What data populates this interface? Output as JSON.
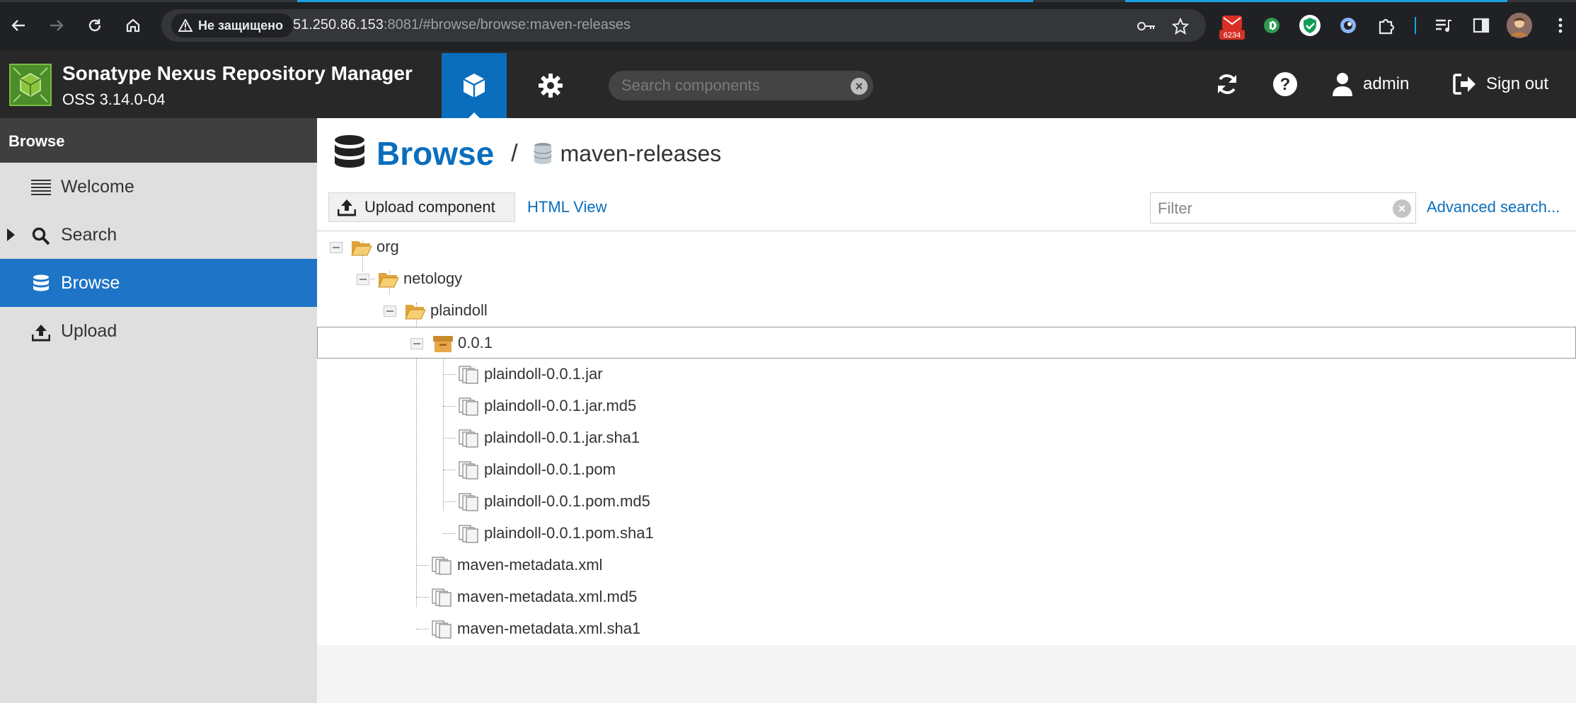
{
  "browser": {
    "security_label": "Не защищено",
    "url_host": "51.250.86.153",
    "url_rest": ":8081/#browse/browse:maven-releases",
    "ext_badge": "6234",
    "accent_color": "#1ba1e2"
  },
  "app": {
    "name": "Sonatype Nexus Repository Manager",
    "version": "OSS 3.14.0-04",
    "search_placeholder": "Search components",
    "user": "admin",
    "signout_label": "Sign out",
    "brand_color": "#0a6ebd"
  },
  "sidebar": {
    "title": "Browse",
    "items": [
      {
        "label": "Welcome",
        "icon": "list-icon"
      },
      {
        "label": "Search",
        "icon": "search-icon"
      },
      {
        "label": "Browse",
        "icon": "database-icon"
      },
      {
        "label": "Upload",
        "icon": "upload-icon"
      }
    ]
  },
  "main": {
    "breadcrumb_title": "Browse",
    "breadcrumb_sep": "/",
    "repo_name": "maven-releases",
    "upload_label": "Upload component",
    "html_view_label": "HTML View",
    "filter_placeholder": "Filter",
    "advanced_search_label": "Advanced search..."
  },
  "tree": [
    {
      "label": "org",
      "type": "folder-open"
    },
    {
      "label": "netology",
      "type": "folder-open"
    },
    {
      "label": "plaindoll",
      "type": "folder-open"
    },
    {
      "label": "0.0.1",
      "type": "component"
    },
    {
      "label": "plaindoll-0.0.1.jar",
      "type": "file"
    },
    {
      "label": "plaindoll-0.0.1.jar.md5",
      "type": "file"
    },
    {
      "label": "plaindoll-0.0.1.jar.sha1",
      "type": "file"
    },
    {
      "label": "plaindoll-0.0.1.pom",
      "type": "file"
    },
    {
      "label": "plaindoll-0.0.1.pom.md5",
      "type": "file"
    },
    {
      "label": "plaindoll-0.0.1.pom.sha1",
      "type": "file"
    },
    {
      "label": "maven-metadata.xml",
      "type": "file"
    },
    {
      "label": "maven-metadata.xml.md5",
      "type": "file"
    },
    {
      "label": "maven-metadata.xml.sha1",
      "type": "file"
    }
  ]
}
